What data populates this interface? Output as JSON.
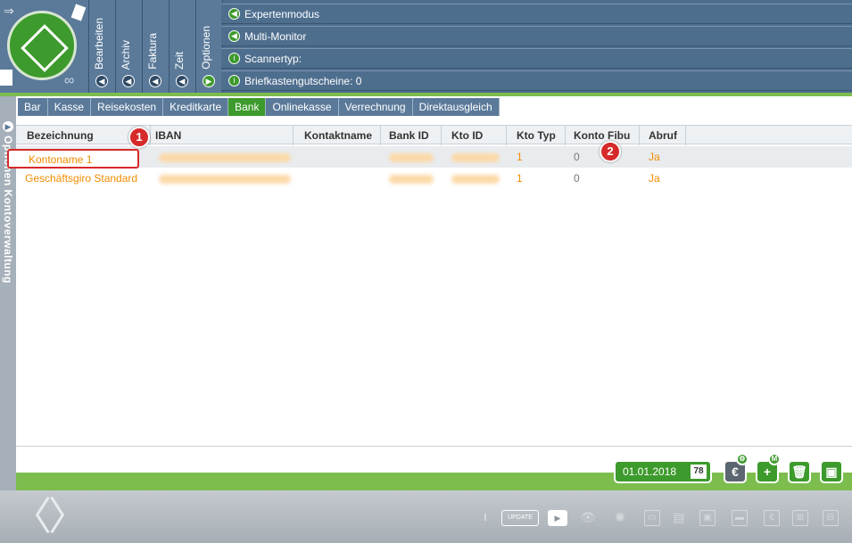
{
  "header": {
    "vertical_tabs": [
      {
        "label": "Bearbeiten"
      },
      {
        "label": "Archiv"
      },
      {
        "label": "Faktura"
      },
      {
        "label": "Zeit"
      },
      {
        "label": "Optionen"
      }
    ],
    "info_rows": [
      {
        "label": "Expertenmodus"
      },
      {
        "label": "Multi-Monitor"
      },
      {
        "label": "Scannertyp:"
      },
      {
        "label": "Briefkastengutscheine: 0"
      }
    ]
  },
  "side_panel": {
    "label": "Optionen  Kontoverwaltung"
  },
  "tabs": [
    {
      "label": "Bar"
    },
    {
      "label": "Kasse"
    },
    {
      "label": "Reisekosten"
    },
    {
      "label": "Kreditkarte"
    },
    {
      "label": "Bank",
      "active": true
    },
    {
      "label": "Onlinekasse"
    },
    {
      "label": "Verrechnung"
    },
    {
      "label": "Direktausgleich"
    }
  ],
  "table": {
    "columns": [
      "Bezeichnung",
      "IBAN",
      "Kontaktname",
      "Bank ID",
      "Kto ID",
      "Kto Typ",
      "Konto Fibu",
      "Abruf"
    ],
    "rows": [
      {
        "bezeichnung": "Kontoname 1",
        "kto_typ": "1",
        "konto_fibu": "0",
        "abruf": "Ja"
      },
      {
        "bezeichnung": "Geschäftsgiro Standard",
        "kto_typ": "1",
        "konto_fibu": "0",
        "abruf": "Ja"
      }
    ]
  },
  "annotations": {
    "badge_1": "1",
    "badge_2": "2"
  },
  "bottom_bar": {
    "date": "01.01.2018",
    "calendar_icon_text": "78"
  },
  "footer": {
    "update_label": "UPDATE"
  },
  "colors": {
    "header": "#4e6e8e",
    "accent_green": "#3d9a2c",
    "link_orange": "#f28c00",
    "highlight_red": "#d62a2a"
  }
}
